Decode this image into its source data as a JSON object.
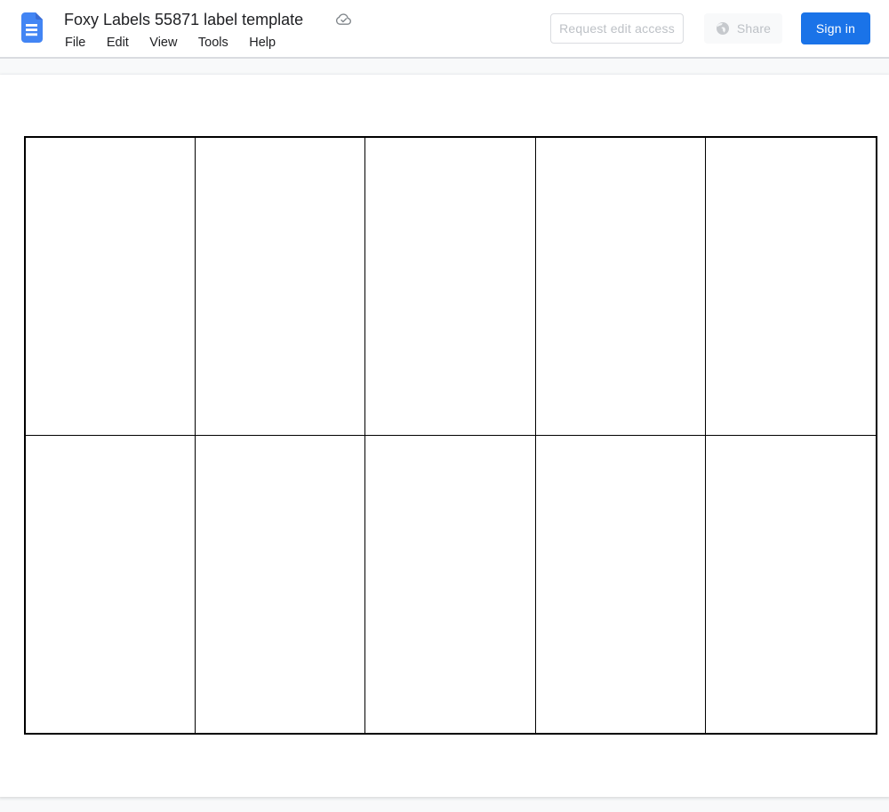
{
  "header": {
    "title": "Foxy Labels 55871 label template",
    "doc_icon": "google-docs-icon",
    "save_status_icon": "cloud-check-icon",
    "menubar": {
      "items": [
        "File",
        "Edit",
        "View",
        "Tools",
        "Help"
      ]
    },
    "buttons": {
      "request_edit_access": {
        "label": "Request edit access"
      },
      "share": {
        "label": "Share",
        "icon": "globe-icon"
      },
      "sign_in": {
        "label": "Sign in"
      }
    }
  },
  "document": {
    "label_grid": {
      "rows": 2,
      "columns": 5,
      "cell_content": ""
    }
  },
  "colors": {
    "accent_blue": "#1a73e8",
    "docs_icon_blue": "#4285f4",
    "docs_icon_fold": "#3a6cd4",
    "header_border": "#dadce0",
    "muted_button_text": "#bdc1c6",
    "menu_text": "#202124",
    "canvas_background": "#f8f9fa",
    "table_border": "#000000",
    "page_background": "#ffffff"
  }
}
